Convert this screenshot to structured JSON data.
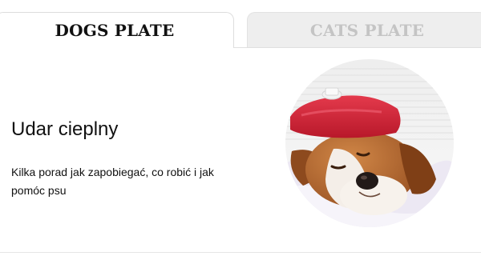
{
  "tabs": [
    {
      "label": "DOGS PLATE",
      "active": true
    },
    {
      "label": "CATS PLATE",
      "active": false
    }
  ],
  "article": {
    "title": "Udar cieplny",
    "description": "Kilka porad jak zapobiegać, co robić i jak pomóc psu"
  },
  "image": {
    "subject": "beagle-with-ice-pack"
  },
  "colors": {
    "active_text": "#111111",
    "inactive_text": "#c4c4c4",
    "inactive_tab_bg": "#eeeeee",
    "ice_pack": "#d8283a"
  }
}
